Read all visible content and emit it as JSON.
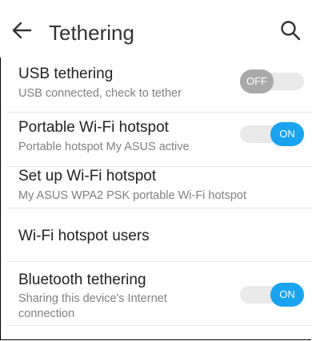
{
  "header": {
    "title": "Tethering",
    "back_icon": "arrow-left-icon",
    "search_icon": "search-icon"
  },
  "items": [
    {
      "title": "USB tethering",
      "subtitle": "USB connected, check to tether",
      "toggle": {
        "state": "off",
        "label": "OFF"
      }
    },
    {
      "title": "Portable Wi-Fi hotspot",
      "subtitle": "Portable hotspot My ASUS active",
      "toggle": {
        "state": "on",
        "label": "ON"
      }
    },
    {
      "title": "Set up Wi-Fi hotspot",
      "subtitle": "My ASUS WPA2 PSK portable Wi-Fi hotspot"
    },
    {
      "title": "Wi-Fi hotspot users"
    },
    {
      "title": "Bluetooth tethering",
      "subtitle_line1": "Sharing this device's Internet",
      "subtitle_line2": "connection",
      "toggle": {
        "state": "on",
        "label": "ON"
      }
    }
  ],
  "colors": {
    "accent": "#1aa3f0",
    "toggle_off_thumb": "#a9a9a9",
    "toggle_track": "#e9e9e9",
    "title_text": "#222222",
    "subtitle_text": "#808080"
  }
}
